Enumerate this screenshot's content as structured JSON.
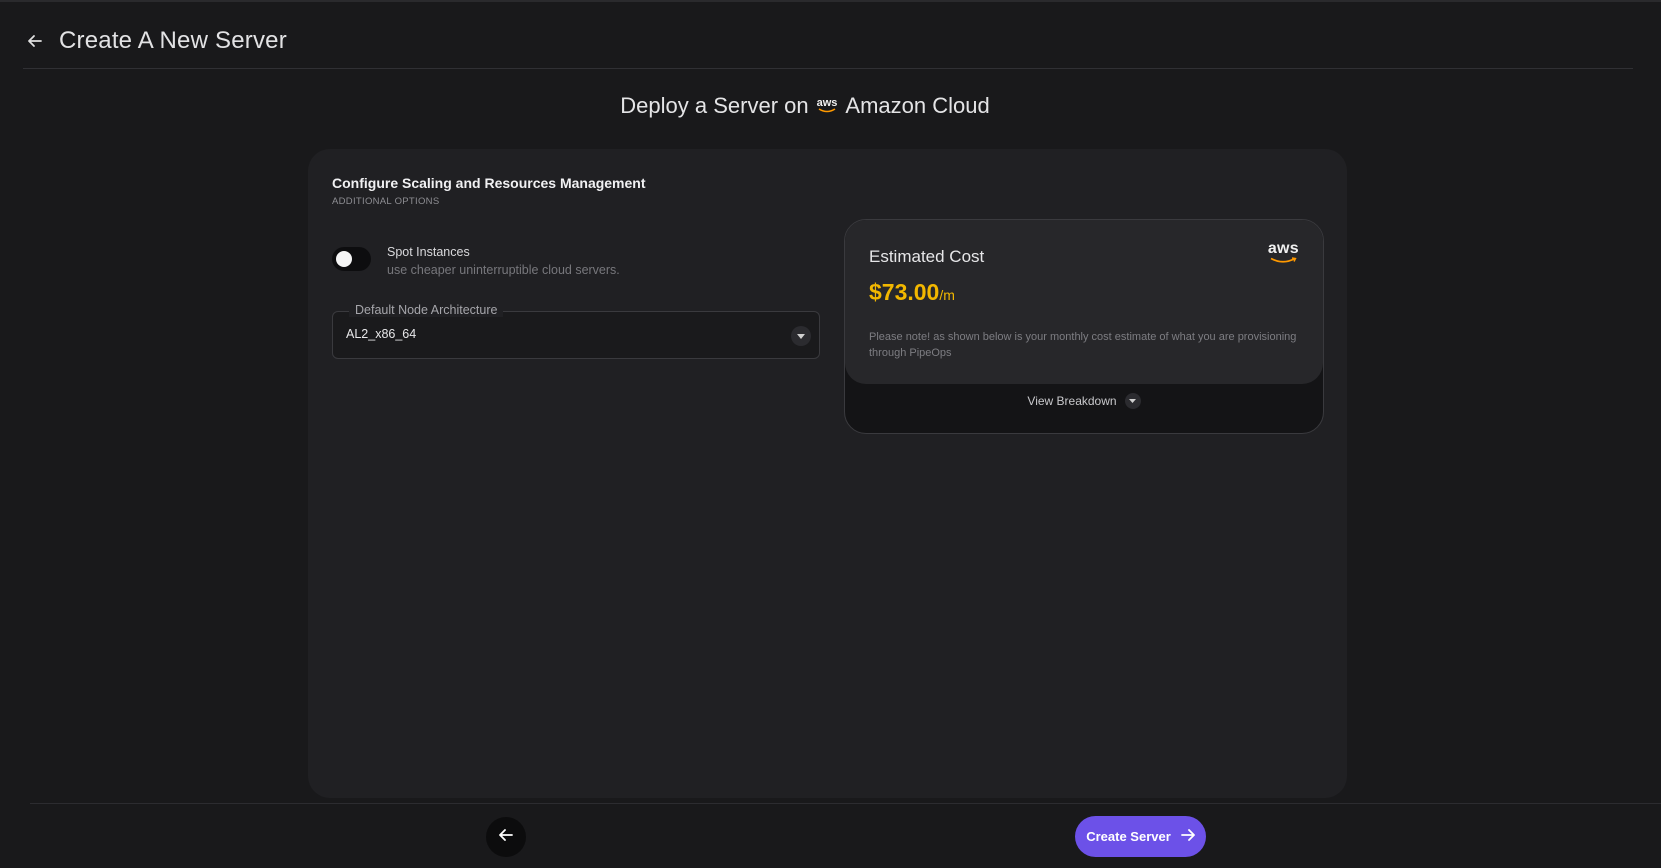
{
  "header": {
    "title": "Create A New Server",
    "back_icon": "arrow-left-icon"
  },
  "deploy": {
    "prefix": "Deploy a Server on",
    "provider_logo_text": "aws",
    "provider": "Amazon Cloud"
  },
  "config": {
    "title": "Configure Scaling and Resources Management",
    "subtitle": "ADDITIONAL OPTIONS",
    "spot": {
      "label": "Spot Instances",
      "description": "use cheaper uninterruptible cloud servers.",
      "enabled": false
    },
    "architecture": {
      "label": "Default Node Architecture",
      "value": "AL2_x86_64"
    }
  },
  "cost": {
    "title": "Estimated Cost",
    "amount": "$73.00",
    "unit": "/m",
    "note": "Please note! as shown below is your monthly cost estimate of what you are provisioning through PipeOps",
    "logo_text": "aws",
    "breakdown_label": "View Breakdown"
  },
  "footer": {
    "create_label": "Create Server"
  },
  "colors": {
    "accent": "#6c51e8",
    "cost": "#f2b700",
    "aws_smile": "#ff9900"
  }
}
